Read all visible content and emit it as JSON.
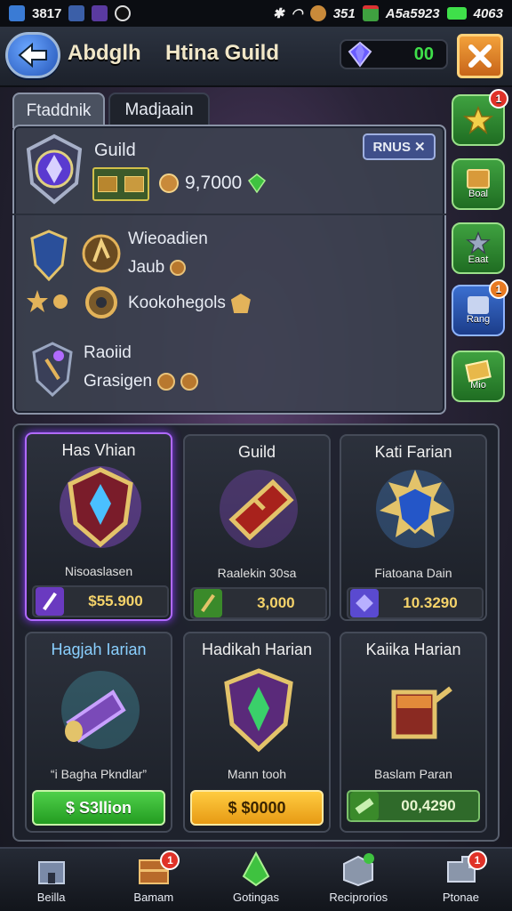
{
  "status_bar": {
    "left_text": "3817",
    "right_a": "351",
    "right_b": "A5a5923",
    "right_c": "4063"
  },
  "header": {
    "title_left": "Abdglh",
    "title_right": "Htina Guild",
    "currency_value": "00"
  },
  "tabs": [
    "Ftaddnik",
    "Madjaain"
  ],
  "guild": {
    "label": "Guild",
    "bonus_label": "RNUS",
    "gold_value": "9,7000"
  },
  "info": {
    "line1": "Wieoadien",
    "line2": "Jaub",
    "line3": "Kookohegols",
    "line4": "Raoiid",
    "line5": "Grasigen"
  },
  "side_buttons": [
    {
      "label": "",
      "badge": "1"
    },
    {
      "label": "Boal",
      "badge": ""
    },
    {
      "label": "Eaat",
      "badge": ""
    },
    {
      "label": "Rang",
      "badge": "1"
    },
    {
      "label": "Mio",
      "badge": ""
    }
  ],
  "cards": [
    {
      "title": "Has Vhian",
      "sub": "Nisoaslasen",
      "price": "$55.900"
    },
    {
      "title": "Guild",
      "sub": "Raalekin 30sa",
      "price": " 3,000"
    },
    {
      "title": "Kati Farian",
      "sub": "Fiatoana Dain",
      "price": "10.3290"
    },
    {
      "title": "Hagjah Iarian",
      "sub": "“i Bagha Pkndlar”",
      "price": "$ S3llion"
    },
    {
      "title": "Hadikah Harian",
      "sub": "Mann tooh",
      "price": "$ $0000"
    },
    {
      "title": "Kaiika Harian",
      "sub": "Baslam Paran",
      "price": "00,4290"
    }
  ],
  "bottom_nav": [
    {
      "label": "Beilla",
      "badge": ""
    },
    {
      "label": "Bamam",
      "badge": "1"
    },
    {
      "label": "Gotingas",
      "badge": ""
    },
    {
      "label": "Reciprorios",
      "badge": ""
    },
    {
      "label": "Ptonae",
      "badge": "1"
    }
  ],
  "colors": {
    "accent_green": "#3fe04a",
    "gold": "#f5d36a",
    "highlight_purple": "#b06aff",
    "back_blue": "#2455b8",
    "close_orange": "#e79a14"
  }
}
